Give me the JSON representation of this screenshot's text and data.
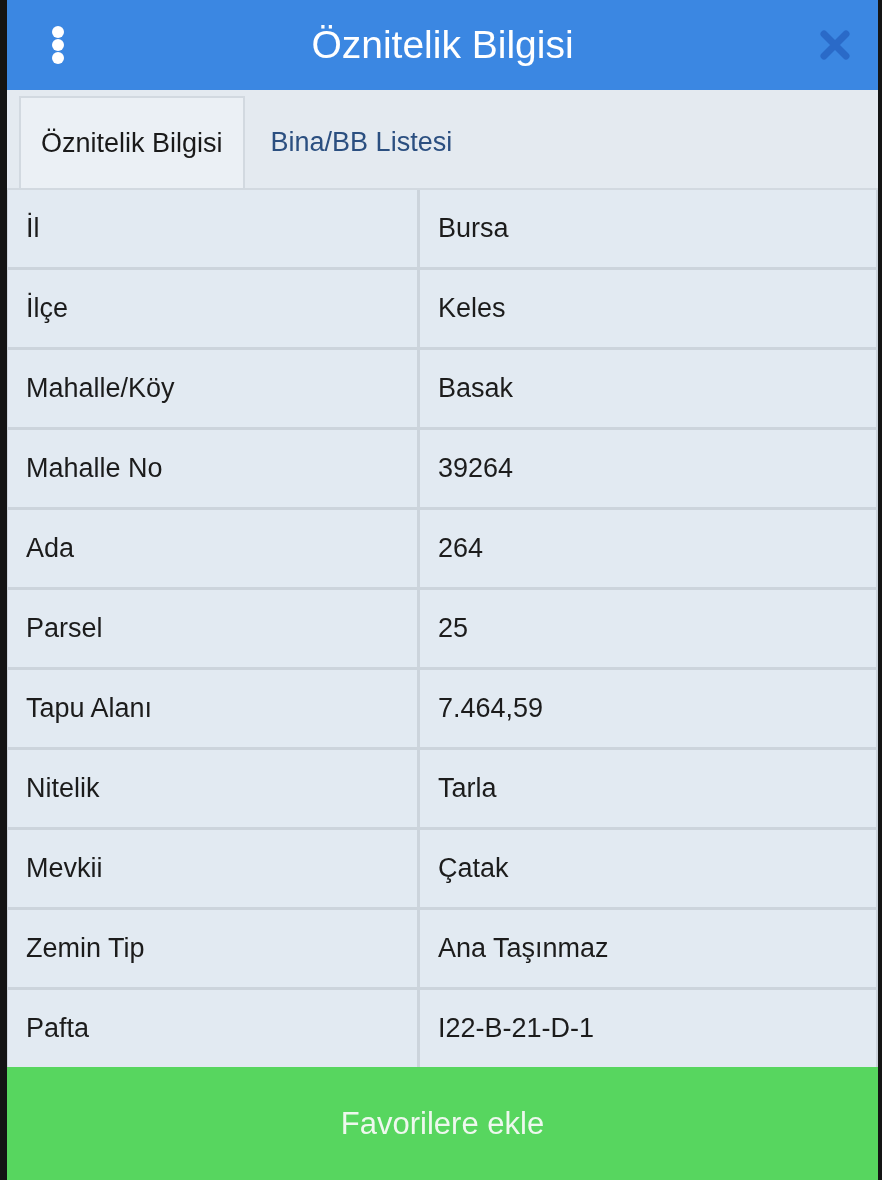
{
  "header": {
    "title": "Öznitelik Bilgisi"
  },
  "tabs": [
    {
      "label": "Öznitelik Bilgisi",
      "selected": true
    },
    {
      "label": "Bina/BB Listesi",
      "selected": false
    }
  ],
  "rows": [
    {
      "label": "İl",
      "value": "Bursa"
    },
    {
      "label": "İlçe",
      "value": "Keles"
    },
    {
      "label": "Mahalle/Köy",
      "value": "Basak"
    },
    {
      "label": "Mahalle No",
      "value": "39264"
    },
    {
      "label": "Ada",
      "value": "264"
    },
    {
      "label": "Parsel",
      "value": "25"
    },
    {
      "label": "Tapu Alanı",
      "value": "7.464,59"
    },
    {
      "label": "Nitelik",
      "value": "Tarla"
    },
    {
      "label": "Mevkii",
      "value": "Çatak"
    },
    {
      "label": "Zemin Tip",
      "value": "Ana Taşınmaz"
    },
    {
      "label": "Pafta",
      "value": "I22-B-21-D-1"
    }
  ],
  "footer_button": {
    "label": "Favorilere ekle"
  }
}
